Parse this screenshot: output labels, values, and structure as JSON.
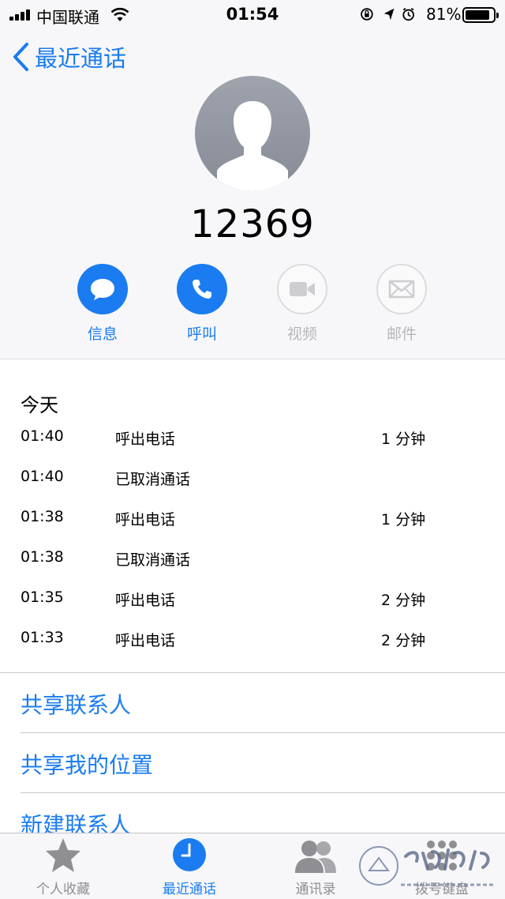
{
  "status_bar": {
    "carrier": "中国联通",
    "time": "01:54",
    "battery_percent": "81%",
    "icons": [
      "signal-icon",
      "wifi-icon",
      "orientation-lock-icon",
      "location-icon",
      "alarm-icon",
      "battery-icon"
    ]
  },
  "nav": {
    "back_label": "最近通话"
  },
  "contact": {
    "number": "12369"
  },
  "actions": [
    {
      "label": "信息",
      "icon": "message-icon",
      "enabled": true
    },
    {
      "label": "呼叫",
      "icon": "phone-icon",
      "enabled": true
    },
    {
      "label": "视频",
      "icon": "video-icon",
      "enabled": false
    },
    {
      "label": "邮件",
      "icon": "mail-icon",
      "enabled": false
    }
  ],
  "recents": {
    "title": "今天",
    "rows": [
      {
        "time": "01:40",
        "kind": "呼出电话",
        "duration": "1 分钟"
      },
      {
        "time": "01:40",
        "kind": "已取消通话",
        "duration": ""
      },
      {
        "time": "01:38",
        "kind": "呼出电话",
        "duration": "1 分钟"
      },
      {
        "time": "01:38",
        "kind": "已取消通话",
        "duration": ""
      },
      {
        "time": "01:35",
        "kind": "呼出电话",
        "duration": "2 分钟"
      },
      {
        "time": "01:33",
        "kind": "呼出电话",
        "duration": "2 分钟"
      }
    ]
  },
  "links": [
    "共享联系人",
    "共享我的位置",
    "新建联系人"
  ],
  "tabs": [
    {
      "label": "个人收藏",
      "icon": "star-icon",
      "active": false
    },
    {
      "label": "最近通话",
      "icon": "clock-icon",
      "active": true
    },
    {
      "label": "通讯录",
      "icon": "contacts-icon",
      "active": false
    },
    {
      "label": "拨号键盘",
      "icon": "keypad-icon",
      "active": false
    }
  ],
  "watermark": {
    "text": "常德论坛",
    "url": "bbs.changde.gov.cn"
  },
  "colors": {
    "accent": "#1a7cf0",
    "disabled": "#b6b6bb",
    "header_bg": "#f7f7f9"
  }
}
